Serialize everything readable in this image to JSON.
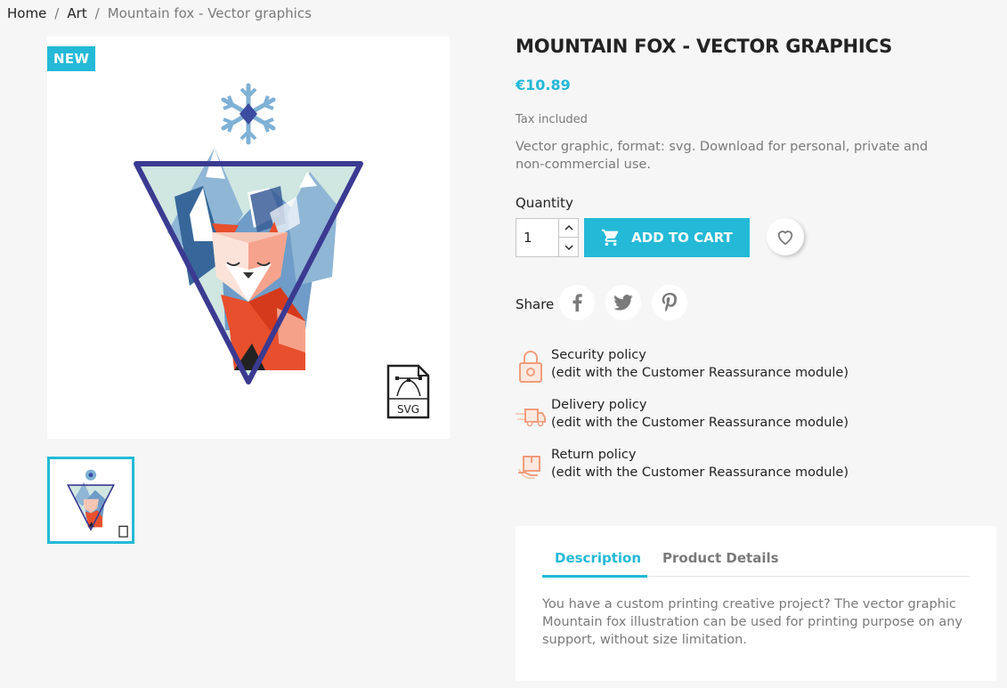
{
  "breadcrumb": {
    "items": [
      "Home",
      "Art"
    ],
    "current": "Mountain fox - Vector graphics"
  },
  "product": {
    "badge": "NEW",
    "title": "MOUNTAIN FOX - VECTOR GRAPHICS",
    "price": "€10.89",
    "tax_note": "Tax included",
    "short_description": "Vector graphic, format: svg. Download for personal, private and non-commercial use.",
    "svg_file_label": "SVG"
  },
  "purchase": {
    "quantity_label": "Quantity",
    "quantity_value": "1",
    "add_to_cart_label": "ADD TO CART"
  },
  "share": {
    "label": "Share",
    "networks": [
      "facebook-icon",
      "twitter-icon",
      "pinterest-icon"
    ]
  },
  "reassurance": [
    {
      "title": "Security policy",
      "subtitle": "(edit with the Customer Reassurance module)",
      "icon": "lock-icon"
    },
    {
      "title": "Delivery policy",
      "subtitle": "(edit with the Customer Reassurance module)",
      "icon": "delivery-truck-icon"
    },
    {
      "title": "Return policy",
      "subtitle": "(edit with the Customer Reassurance module)",
      "icon": "return-box-icon"
    }
  ],
  "tabs": {
    "items": [
      {
        "label": "Description",
        "active": true
      },
      {
        "label": "Product Details",
        "active": false
      }
    ],
    "description_text": "You have a custom printing creative project? The vector graphic Mountain fox illustration can be used for printing purpose on any support, without size limitation."
  },
  "colors": {
    "accent": "#24b9d7",
    "text": "#232323",
    "muted": "#7a7a7a",
    "background": "#f6f6f6"
  }
}
